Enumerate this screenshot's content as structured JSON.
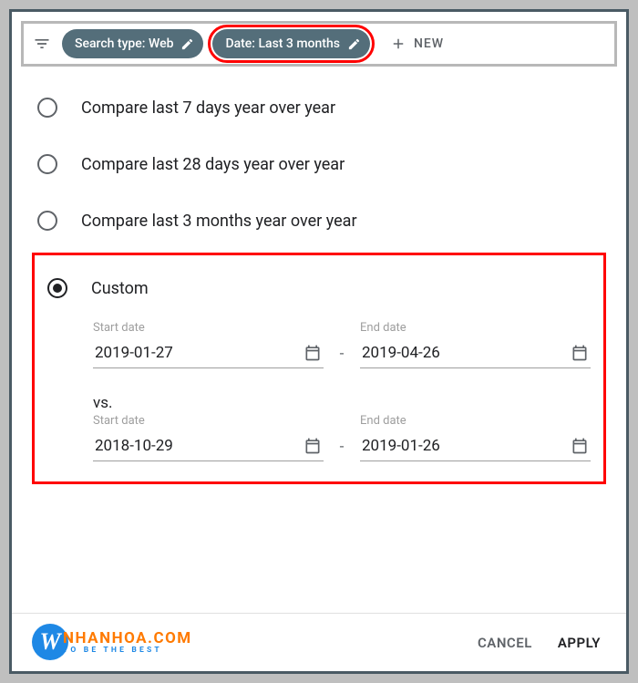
{
  "topbar": {
    "chip_search": "Search type: Web",
    "chip_date": "Date: Last 3 months",
    "new_label": "NEW"
  },
  "options": {
    "o1": "Compare last 7 days year over year",
    "o2": "Compare last 28 days year over year",
    "o3": "Compare last 3 months year over year",
    "custom": "Custom"
  },
  "dates": {
    "start_lbl": "Start date",
    "end_lbl": "End date",
    "vs": "vs.",
    "r1_start": "2019-01-27",
    "r1_end": "2019-04-26",
    "r2_start": "2018-10-29",
    "r2_end": "2019-01-26"
  },
  "footer": {
    "cancel": "CANCEL",
    "apply": "APPLY"
  },
  "brand": {
    "letter": "W",
    "name": "NHANHOA.COM",
    "tagline": "TO BE THE BEST"
  }
}
